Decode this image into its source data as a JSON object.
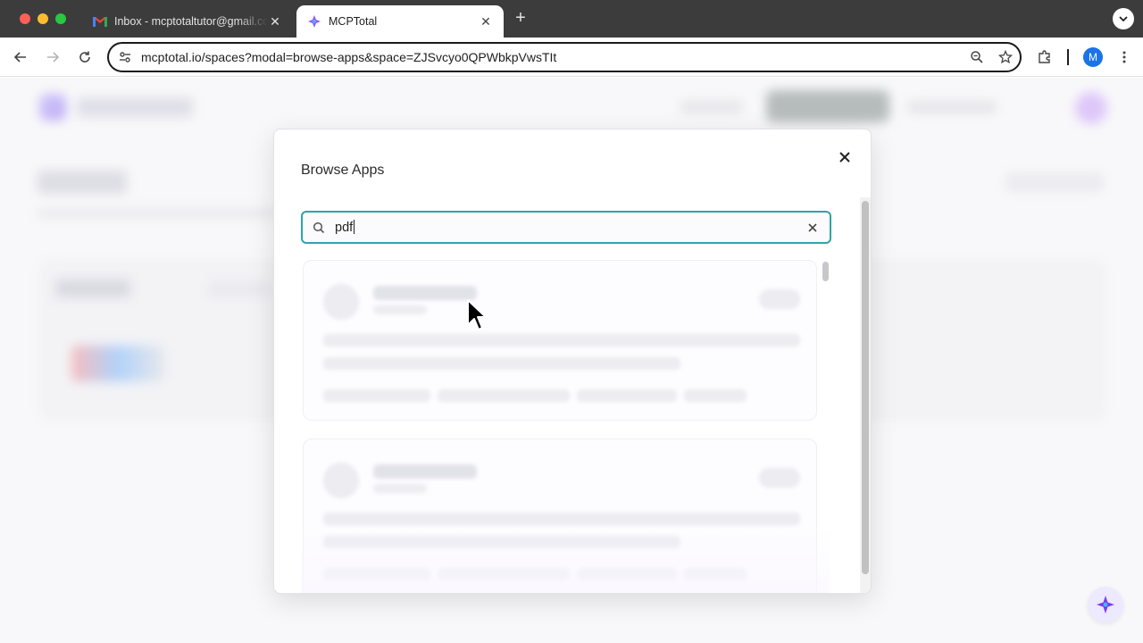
{
  "browser": {
    "tabs": [
      {
        "title": "Inbox - mcptotaltutor@gmail.com - Gmail",
        "favicon": "gmail-icon",
        "active": false
      },
      {
        "title": "MCPTotal",
        "favicon": "mcptotal-icon",
        "active": true
      }
    ],
    "new_tab_label": "+",
    "url": "mcptotal.io/spaces?modal=browse-apps&space=ZJSvcyo0QPWbkpVwsTIt",
    "profile_initial": "M",
    "colors": {
      "tabbar": "#3c3c3c",
      "profile": "#1a73e8"
    }
  },
  "modal": {
    "title": "Browse Apps",
    "search": {
      "value": "pdf",
      "placeholder": ""
    },
    "state": "loading",
    "accent": "#2fa4a6"
  }
}
